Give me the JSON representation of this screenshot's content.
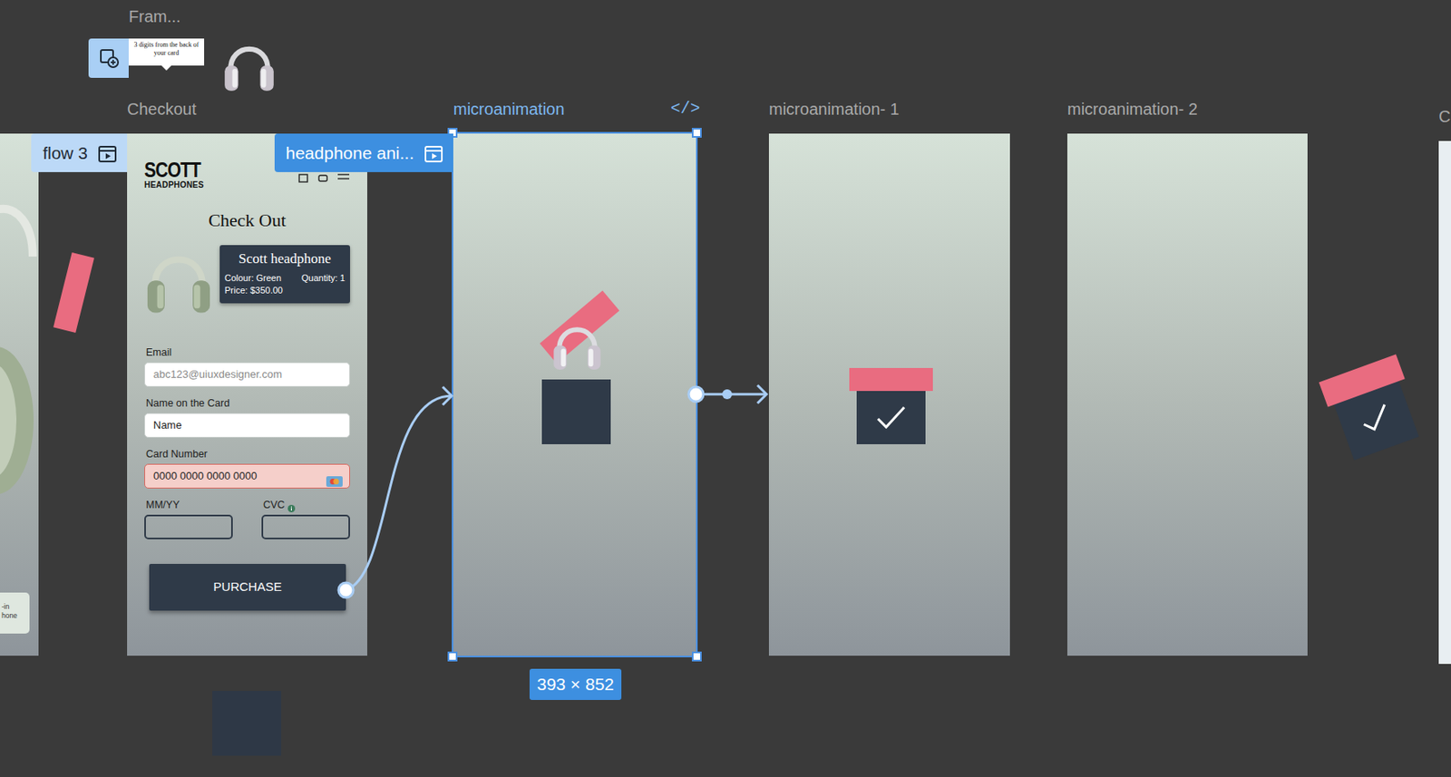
{
  "top_frame": {
    "label": "Fram...",
    "tooltip": "3 digits from the back of your card"
  },
  "flow_tags": [
    {
      "label": "flow 3",
      "selected": false
    },
    {
      "label": "headphone ani...",
      "selected": true
    }
  ],
  "frames": [
    {
      "label": "Checkout",
      "selected": false
    },
    {
      "label": "microanimation",
      "selected": true
    },
    {
      "label": "microanimation- 1",
      "selected": false
    },
    {
      "label": "microanimation- 2",
      "selected": false
    },
    {
      "label": "C",
      "selected": false
    }
  ],
  "code_icon": "</>",
  "size_badge": "393 × 852",
  "left_frame": {
    "fragments": [
      "-in",
      "hone"
    ]
  },
  "checkout": {
    "logo": {
      "line1": "SCOTT",
      "line2": "HEADPHONES"
    },
    "title": "Check Out",
    "product": {
      "name": "Scott headphone",
      "colour": "Colour: Green",
      "quantity": "Quantity: 1",
      "price": "Price: $350.00"
    },
    "fields": [
      {
        "label": "Email",
        "placeholder": "abc123@uiuxdesigner.com",
        "kind": "text",
        "error": false,
        "info": false
      },
      {
        "label": "Name on the Card",
        "value": "Name",
        "kind": "text",
        "error": false,
        "info": false
      },
      {
        "label": "Card Number",
        "value": "0000 0000 0000 0000",
        "kind": "card",
        "error": true,
        "info": false
      },
      {
        "label": "MM/YY",
        "value": "",
        "kind": "short",
        "error": false,
        "info": false
      },
      {
        "label": "CVC",
        "value": "",
        "kind": "short",
        "error": false,
        "info": true
      }
    ],
    "button": "PURCHASE"
  }
}
